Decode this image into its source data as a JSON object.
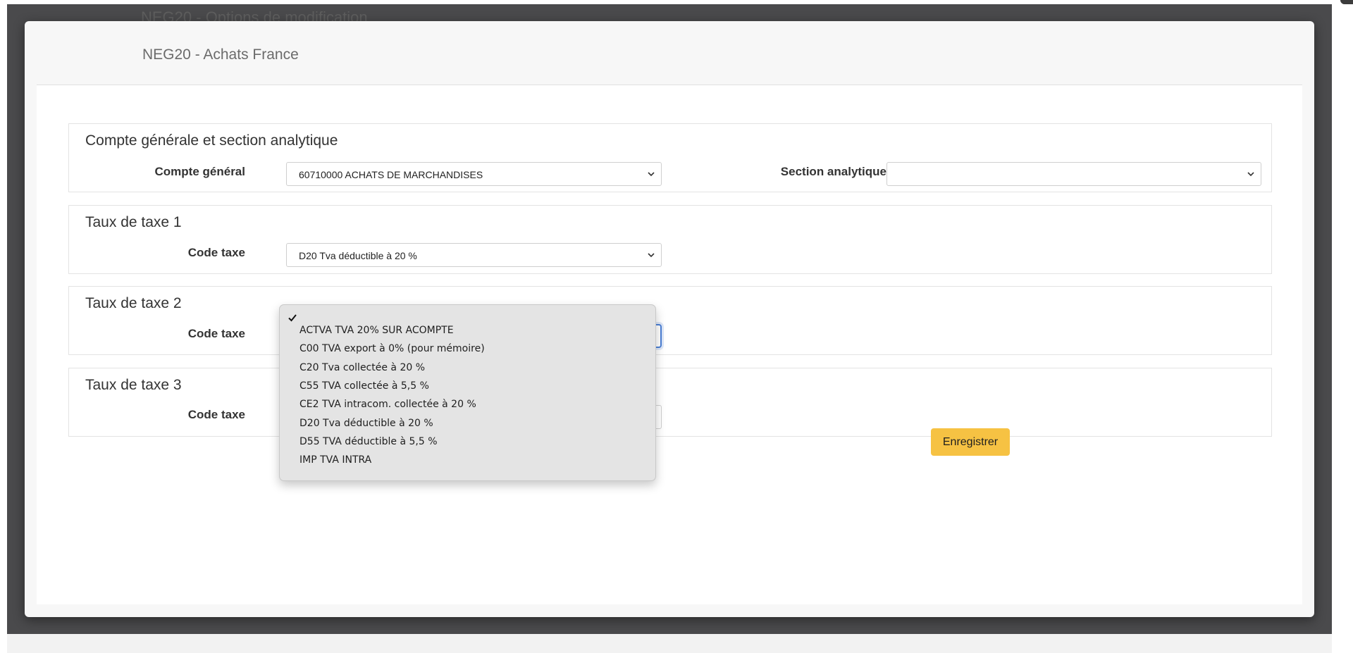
{
  "background": {
    "ghost_text": "NEG20 - Options de modification"
  },
  "modal": {
    "title": "NEG20 - Achats France"
  },
  "sections": {
    "account": {
      "title": "Compte générale et section analytique",
      "compte_label": "Compte général",
      "compte_value": "60710000 ACHATS DE MARCHANDISES",
      "section_label": "Section analytique",
      "section_value": ""
    },
    "tax1": {
      "title": "Taux de taxe 1",
      "code_label": "Code taxe",
      "code_value": "D20 Tva déductible à 20 %"
    },
    "tax2": {
      "title": "Taux de taxe 2",
      "code_label": "Code taxe",
      "code_value": ""
    },
    "tax3": {
      "title": "Taux de taxe 3",
      "code_label": "Code taxe",
      "code_value": ""
    }
  },
  "dropdown": {
    "selected_index": 0,
    "options": [
      "ACTVA TVA 20% SUR ACOMPTE",
      "C00 TVA export à 0% (pour mémoire)",
      "C20 Tva collectée à 20 %",
      "C55 TVA collectée à 5,5 %",
      "CE2 TVA intracom. collectée à 20 %",
      "D20 Tva déductible à 20 %",
      "D55 TVA déductible à 5,5 %",
      "IMP TVA INTRA"
    ]
  },
  "actions": {
    "save_label": "Enregistrer"
  },
  "colors": {
    "backdrop": "#4a4a4c",
    "accent_button": "#f6c243",
    "focus_ring": "#4a7fd6"
  }
}
